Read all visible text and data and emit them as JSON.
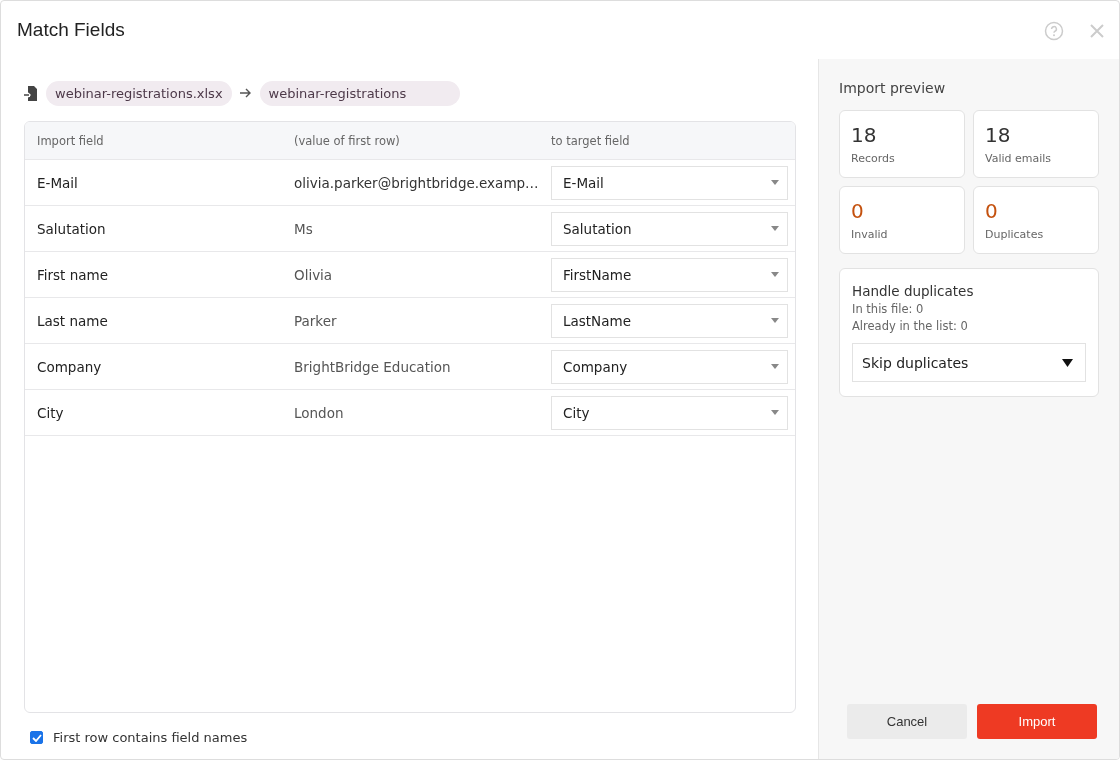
{
  "window": {
    "title": "Match Fields"
  },
  "source": {
    "file": "webinar-registrations.xlsx",
    "target": "webinar-registrations"
  },
  "table": {
    "columns": [
      "Import field",
      "(value of first row)",
      "to target field"
    ],
    "rows": [
      {
        "field": "E-Mail",
        "value": "olivia.parker@brightbridge.examp…",
        "target": "E-Mail",
        "emphasis": true
      },
      {
        "field": "Salutation",
        "value": "Ms",
        "target": "Salutation",
        "emphasis": false
      },
      {
        "field": "First name",
        "value": "Olivia",
        "target": "FirstName",
        "emphasis": false
      },
      {
        "field": "Last name",
        "value": "Parker",
        "target": "LastName",
        "emphasis": false
      },
      {
        "field": "Company",
        "value": "BrightBridge Education",
        "target": "Company",
        "emphasis": false
      },
      {
        "field": "City",
        "value": "London",
        "target": "City",
        "emphasis": false
      }
    ]
  },
  "first_row_names": {
    "label": "First row contains field names",
    "checked": true
  },
  "preview": {
    "title": "Import preview",
    "stats": [
      {
        "value": "18",
        "label": "Records",
        "color": "#333333"
      },
      {
        "value": "18",
        "label": "Valid emails",
        "color": "#333333"
      },
      {
        "value": "0",
        "label": "Invalid",
        "color": "#c4510e"
      },
      {
        "value": "0",
        "label": "Duplicates",
        "color": "#c4510e"
      }
    ]
  },
  "duplicates": {
    "title": "Handle duplicates",
    "lines": [
      "In this file: 0",
      "Already in the list: 0"
    ],
    "option": "Skip duplicates"
  },
  "buttons": {
    "cancel": "Cancel",
    "import": "Import"
  }
}
